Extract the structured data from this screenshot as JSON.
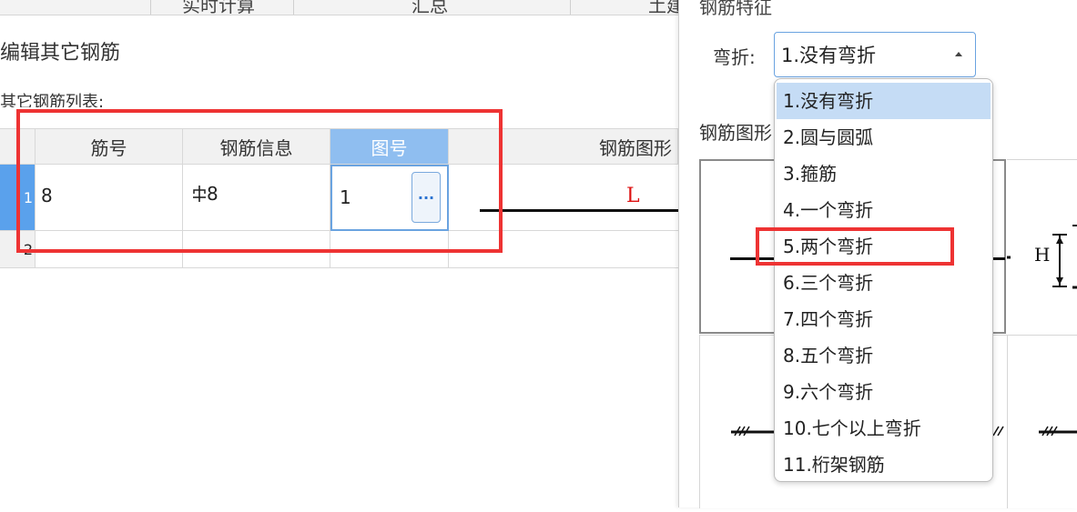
{
  "tabs": [
    {
      "label": "实时计算"
    },
    {
      "label": "汇总"
    },
    {
      "label": "土建"
    }
  ],
  "dialog": {
    "title": "编辑其它钢筋",
    "list_label": "其它钢筋列表:"
  },
  "table": {
    "headers": [
      "",
      "筋号",
      "钢筋信息",
      "图号",
      "钢筋图形"
    ],
    "rows": [
      {
        "index": "1",
        "bar_no": "8",
        "bar_info": "8",
        "bar_info_icon": "grade-symbol-icon",
        "figure_no": "1",
        "shape_label": "L"
      },
      {
        "index": "2",
        "bar_no": "",
        "bar_info": "",
        "figure_no": "",
        "shape_label": ""
      }
    ],
    "ellipsis_label": "···",
    "grade_symbol": "å"
  },
  "panel": {
    "section_title": "钢筋特征",
    "bend_label": "弯折:",
    "bend_value": "1.没有弯折",
    "shape_label": "钢筋图形"
  },
  "dropdown": {
    "options": [
      "1.没有弯折",
      "2.圆与圆弧",
      "3.箍筋",
      "4.一个弯折",
      "5.两个弯折",
      "6.三个弯折",
      "7.四个弯折",
      "8.五个弯折",
      "9.六个弯折",
      "10.七个以上弯折",
      "11.桁架钢筋"
    ],
    "selected_index": 0,
    "highlighted_index": 4
  },
  "previews": {
    "dim_h": "H"
  },
  "colors": {
    "accent": "#5aa1ec",
    "header_active": "#8fbef0",
    "highlight_red": "#ee3333",
    "shape_label_red": "#dd1111"
  }
}
